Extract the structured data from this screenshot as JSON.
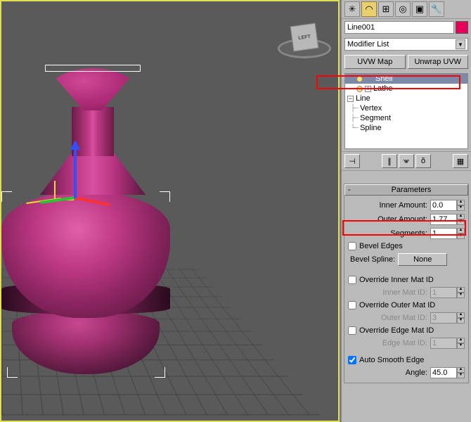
{
  "viewport": {
    "cube_label": "LEFT"
  },
  "panel": {
    "object_name": "Line001",
    "color_hex": "#e6005c",
    "modifier_list_placeholder": "Modifier List",
    "buttons": {
      "uvw_map": "UVW Map",
      "unwrap_uvw": "Unwrap UVW"
    },
    "stack": [
      {
        "label": "Shell",
        "indent": 1,
        "bulb": true,
        "selected": true
      },
      {
        "label": "Lathe",
        "indent": 1,
        "bulb": true,
        "plus": true
      },
      {
        "label": "Line",
        "indent": 0,
        "minus": true
      },
      {
        "label": "Vertex",
        "indent": 2,
        "leaf": true
      },
      {
        "label": "Segment",
        "indent": 2,
        "leaf": true
      },
      {
        "label": "Spline",
        "indent": 2,
        "leaf": true
      }
    ],
    "rollout": {
      "title": "Parameters",
      "inner_amount": {
        "label": "Inner Amount:",
        "value": "0.0"
      },
      "outer_amount": {
        "label": "Outer Amount:",
        "value": "1.77"
      },
      "segments": {
        "label": "Segments:",
        "value": "1"
      },
      "bevel_edges": {
        "label": "Bevel Edges",
        "checked": false
      },
      "bevel_spline": {
        "label": "Bevel Spline:",
        "button": "None"
      },
      "override_inner": {
        "label": "Override Inner Mat ID",
        "checked": false
      },
      "inner_mat_id": {
        "label": "Inner Mat ID:",
        "value": "1"
      },
      "override_outer": {
        "label": "Override Outer Mat ID",
        "checked": false
      },
      "outer_mat_id": {
        "label": "Outer Mat ID:",
        "value": "3"
      },
      "override_edge": {
        "label": "Override Edge Mat ID",
        "checked": false
      },
      "edge_mat_id": {
        "label": "Edge Mat ID:",
        "value": "1"
      },
      "auto_smooth": {
        "label": "Auto Smooth Edge",
        "checked": true
      },
      "angle": {
        "label": "Angle:",
        "value": "45.0"
      }
    }
  }
}
